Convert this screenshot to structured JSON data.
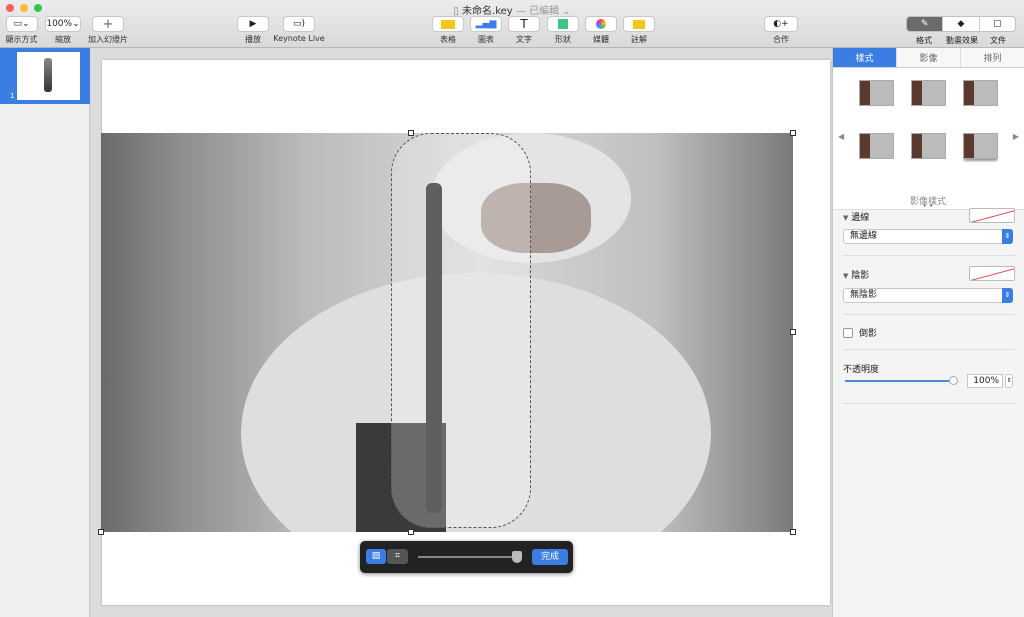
{
  "window": {
    "title": "未命名.key",
    "status": "— 已編輯 ⌄"
  },
  "toolbar": {
    "view": "顯示方式",
    "zoom_value": "100%",
    "zoom": "縮放",
    "add_slide": "加入幻燈片",
    "play": "播放",
    "keynote_live": "Keynote Live",
    "table": "表格",
    "chart": "圖表",
    "text": "文字",
    "shape": "形狀",
    "media": "媒體",
    "comment": "註解",
    "collaborate": "合作",
    "format": "格式",
    "animate": "動畫效果",
    "document": "文件"
  },
  "navigator": {
    "slides": [
      {
        "number": "1",
        "selected": true
      }
    ]
  },
  "mask_bar": {
    "done": "完成",
    "slider_value": 0.95,
    "mode": "image-mask"
  },
  "inspector": {
    "tabs": [
      {
        "label": "樣式",
        "active": true
      },
      {
        "label": "影像",
        "active": false
      },
      {
        "label": "排列",
        "active": false
      }
    ],
    "styles_caption": "影像樣式",
    "border": {
      "label": "邊線",
      "value": "無邊線"
    },
    "shadow": {
      "label": "陰影",
      "value": "無陰影"
    },
    "reflection": {
      "label": "倒影",
      "checked": false
    },
    "opacity": {
      "label": "不透明度",
      "value": "100%",
      "fraction": 1.0
    }
  },
  "colors": {
    "accent": "#3a7ee4",
    "close": "#fc5f57",
    "minimize": "#fdbc2e",
    "zoom": "#33c748"
  }
}
